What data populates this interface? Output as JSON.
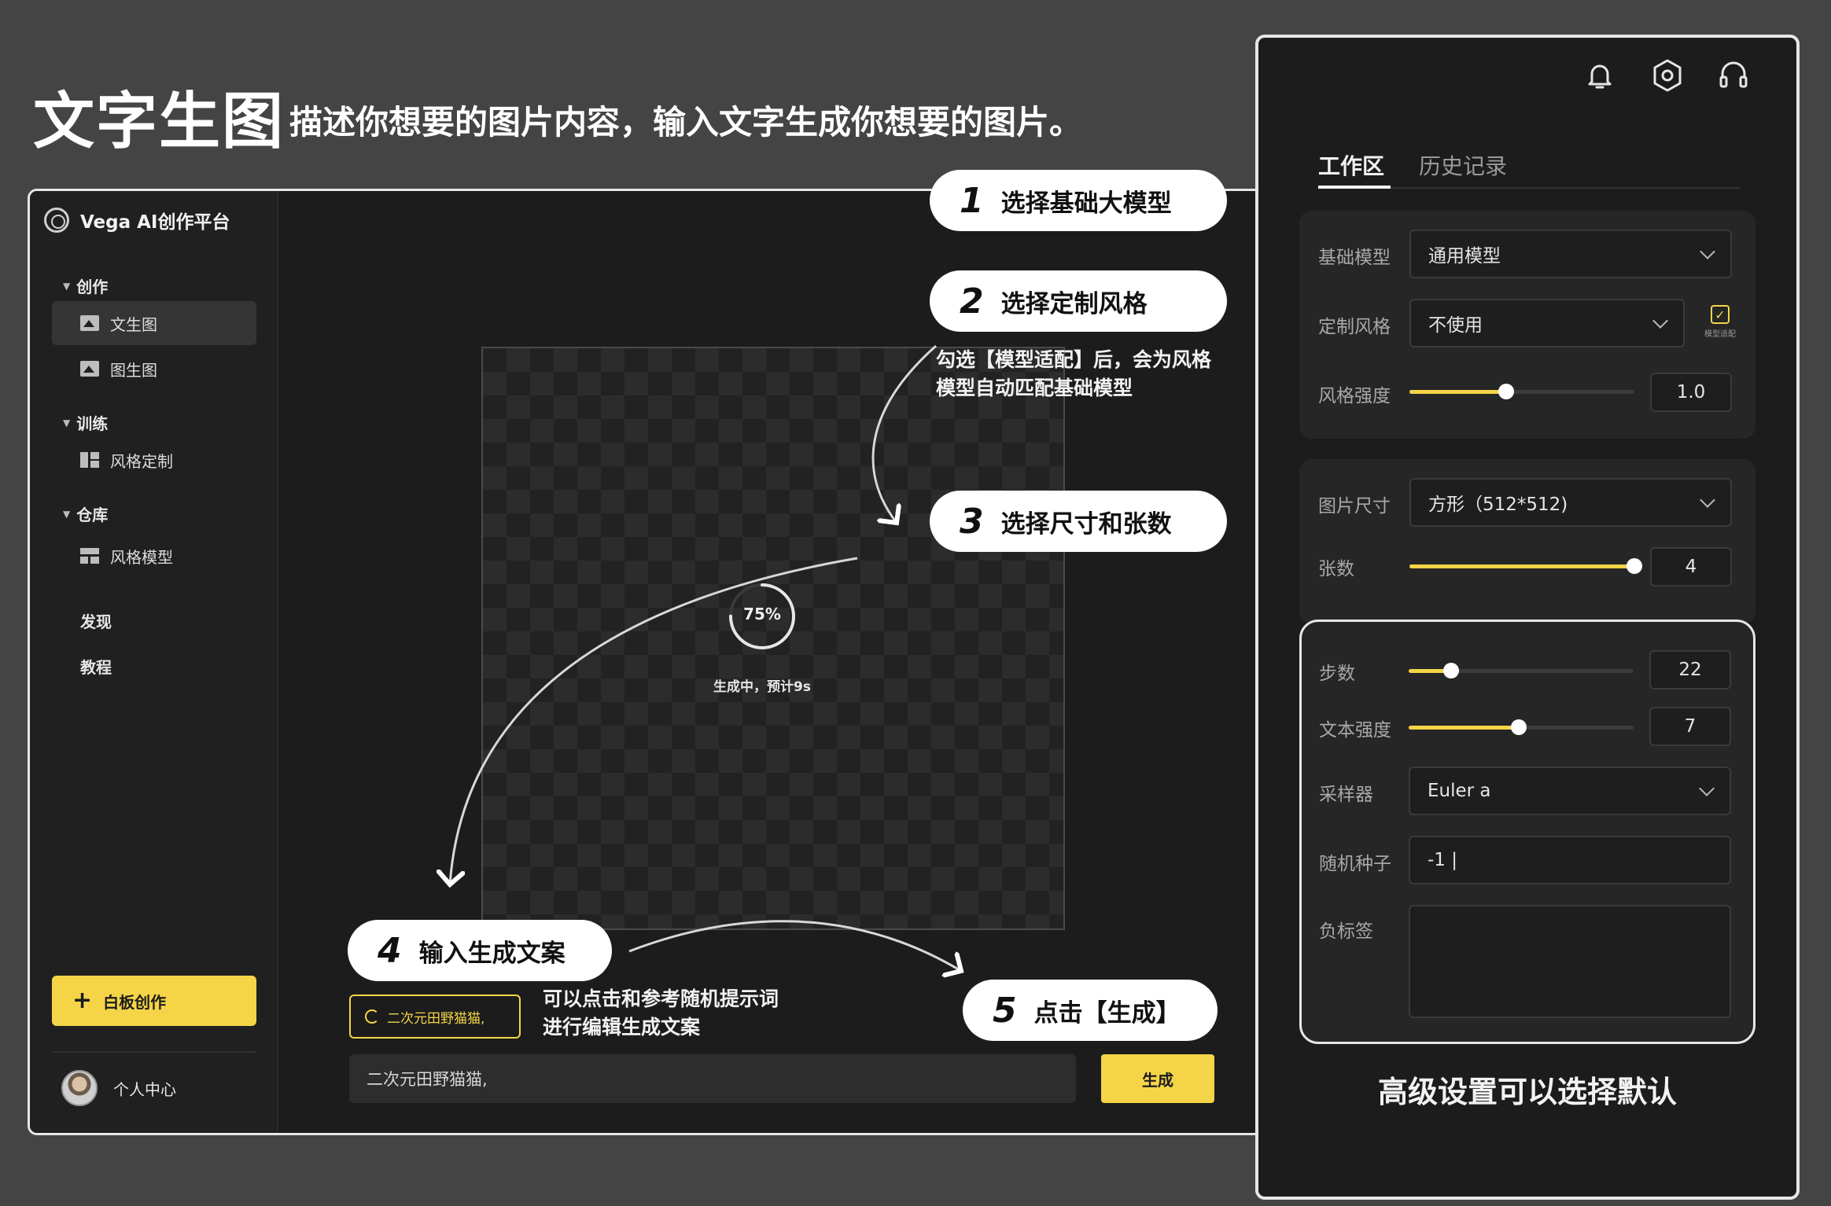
{
  "hero": {
    "title": "文字生图",
    "subtitle": "描述你想要的图片内容，输入文字生成你想要的图片。"
  },
  "sidebar": {
    "brand": "Vega AI创作平台",
    "sections": [
      {
        "label": "创作",
        "items": [
          {
            "label": "文生图",
            "icon": "picture-icon",
            "active": true
          },
          {
            "label": "图生图",
            "icon": "image-icon",
            "active": false
          }
        ]
      },
      {
        "label": "训练",
        "items": [
          {
            "label": "风格定制",
            "icon": "layout-icon",
            "active": false
          }
        ]
      },
      {
        "label": "仓库",
        "items": [
          {
            "label": "风格模型",
            "icon": "model-icon",
            "active": false
          }
        ]
      }
    ],
    "discover": "发现",
    "tutorial": "教程",
    "whiteboard": "白板创作",
    "profile": "个人中心"
  },
  "canvas": {
    "progress_label": "75%",
    "progress": 0.75,
    "status": "生成中，预计9s"
  },
  "bottom": {
    "chip": "二次元田野猫猫,",
    "chip_hint_line1": "可以点击和参考随机提示词",
    "chip_hint_line2": "进行编辑生成文案",
    "prompt_value": "二次元田野猫猫,",
    "generate": "生成"
  },
  "callouts": [
    {
      "num": "1",
      "text": "选择基础大模型"
    },
    {
      "num": "2",
      "text": "选择定制风格"
    },
    {
      "num": "3",
      "text": "选择尺寸和张数"
    },
    {
      "num": "4",
      "text": "输入生成文案"
    },
    {
      "num": "5",
      "text": "点击【生成】"
    }
  ],
  "note_style": {
    "line1": "勾选【模型适配】后，会为风格",
    "line2": "模型自动匹配基础模型"
  },
  "panel": {
    "tabs": [
      "工作区",
      "历史记录"
    ],
    "base_model": {
      "label": "基础模型",
      "value": "通用模型"
    },
    "style": {
      "label": "定制风格",
      "value": "不使用",
      "checkbox_label": "模型适配",
      "checked": true
    },
    "style_strength": {
      "label": "风格强度",
      "value": "1.0",
      "fraction": 0.43
    },
    "size": {
      "label": "图片尺寸",
      "value": "方形（512*512)"
    },
    "count": {
      "label": "张数",
      "value": "4",
      "fraction": 1.0
    },
    "steps": {
      "label": "步数",
      "value": "22",
      "fraction": 0.19
    },
    "text_strength": {
      "label": "文本强度",
      "value": "7",
      "fraction": 0.49
    },
    "sampler": {
      "label": "采样器",
      "value": "Euler a"
    },
    "seed": {
      "label": "随机种子",
      "value": "-1 |"
    },
    "negative": {
      "label": "负标签",
      "value": ""
    },
    "advanced_note": "高级设置可以选择默认"
  },
  "colors": {
    "accent": "#f5d547",
    "bg": "#444444",
    "app_bg": "#1c1c1c"
  }
}
